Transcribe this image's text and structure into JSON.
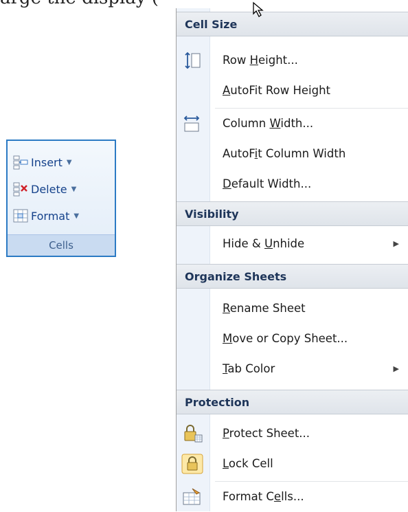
{
  "caption_fragment": "arge the display (",
  "cells_group": {
    "insert_label": "Insert",
    "delete_label": "Delete",
    "format_label": "Format",
    "group_label": "Cells"
  },
  "menu": {
    "cell_size": {
      "header": "Cell Size",
      "row_height": {
        "pre": "Row ",
        "key": "H",
        "post": "eight..."
      },
      "autofit_row_height": {
        "pre": "",
        "key": "A",
        "post": "utoFit Row Height"
      },
      "column_width": {
        "pre": "Column ",
        "key": "W",
        "post": "idth..."
      },
      "autofit_column_width": {
        "pre": "AutoF",
        "key": "i",
        "post": "t Column Width"
      },
      "default_width": {
        "pre": "",
        "key": "D",
        "post": "efault Width..."
      }
    },
    "visibility": {
      "header": "Visibility",
      "hide_unhide": {
        "pre": "Hide & ",
        "key": "U",
        "post": "nhide"
      }
    },
    "organize_sheets": {
      "header": "Organize Sheets",
      "rename_sheet": {
        "pre": "",
        "key": "R",
        "post": "ename Sheet"
      },
      "move_copy_sheet": {
        "pre": "",
        "key": "M",
        "post": "ove or Copy Sheet..."
      },
      "tab_color": {
        "pre": "",
        "key": "T",
        "post": "ab Color"
      }
    },
    "protection": {
      "header": "Protection",
      "protect_sheet": {
        "pre": "",
        "key": "P",
        "post": "rotect Sheet..."
      },
      "lock_cell": {
        "pre": "",
        "key": "L",
        "post": "ock Cell"
      },
      "format_cells": {
        "pre": "Format C",
        "key": "e",
        "post": "lls..."
      }
    }
  }
}
